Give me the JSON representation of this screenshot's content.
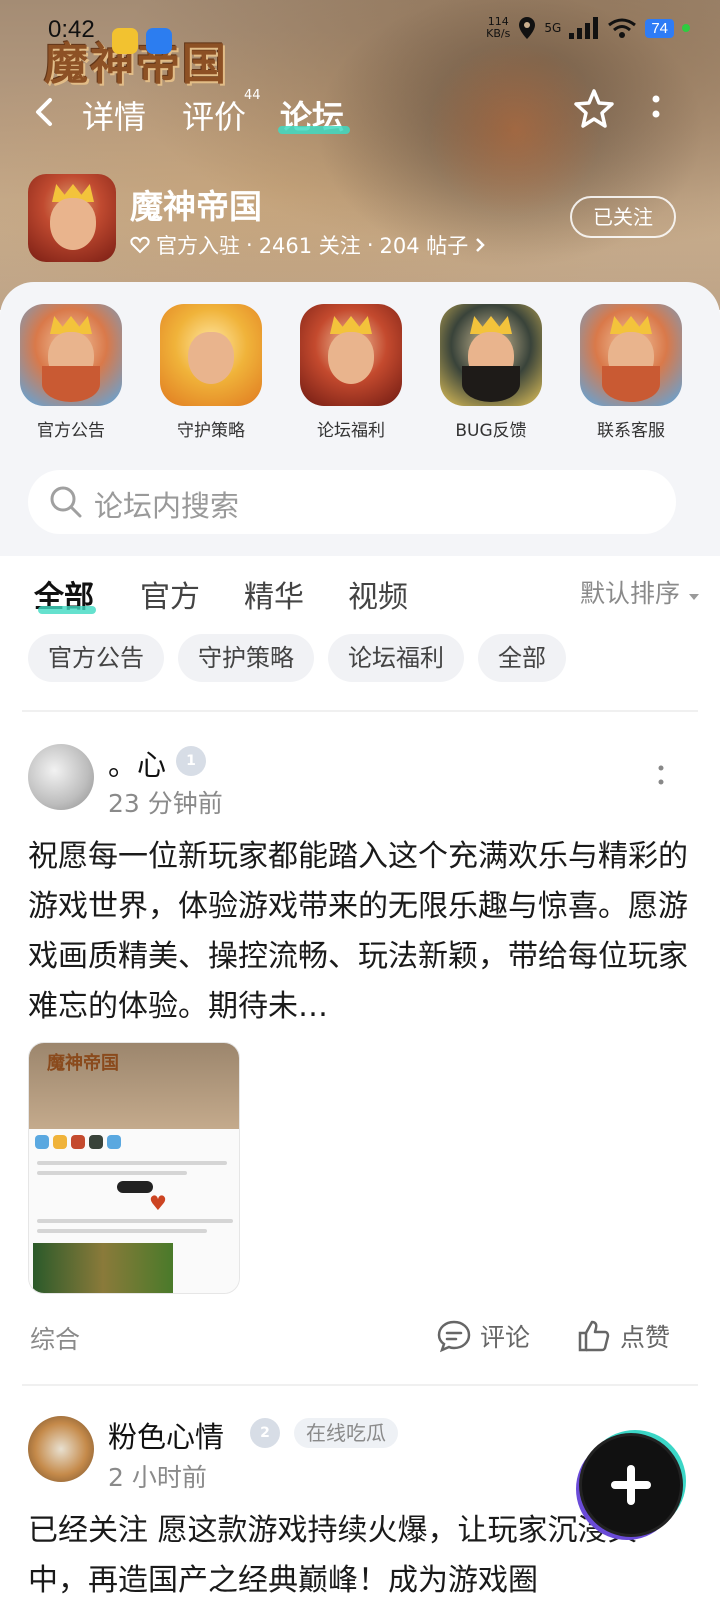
{
  "status_bar": {
    "time": "0:42",
    "net_speed": "114\nKB/s",
    "signal": "5G",
    "battery": "74"
  },
  "hero": {
    "logo_text": "魔神帝国"
  },
  "nav": {
    "tabs": [
      {
        "label": "详情"
      },
      {
        "label": "评价",
        "badge": "44"
      },
      {
        "label": "论坛"
      }
    ]
  },
  "game": {
    "name": "魔神帝国",
    "official": "官方入驻",
    "followers": "2461 关注",
    "posts": "204 帖子",
    "follow_button": "已关注"
  },
  "shortcuts": [
    {
      "label": "官方公告",
      "icon": "blue"
    },
    {
      "label": "守护策略",
      "icon": "gold"
    },
    {
      "label": "论坛福利",
      "icon": "red"
    },
    {
      "label": "BUG反馈",
      "icon": "dark"
    },
    {
      "label": "联系客服",
      "icon": "blue"
    }
  ],
  "search": {
    "placeholder": "论坛内搜索"
  },
  "filter_tabs": {
    "tabs": [
      "全部",
      "官方",
      "精华",
      "视频"
    ],
    "active": "全部",
    "sort": "默认排序"
  },
  "chips": [
    "官方公告",
    "守护策略",
    "论坛福利",
    "全部"
  ],
  "posts": [
    {
      "author": "。心",
      "level": "1",
      "time": "23 分钟前",
      "text": "祝愿每一位新玩家都能踏入这个充满欢乐与精彩的游戏世界，体验游戏带来的无限乐趣与惊喜。愿游戏画质精美、操控流畅、玩法新颖，带给每位玩家难忘的体验。期待未…",
      "category": "综合",
      "comment_label": "评论",
      "like_label": "点赞"
    },
    {
      "author": "粉色心情",
      "level": "2",
      "tag": "在线吃瓜",
      "time": "2 小时前",
      "text": "已经关注  愿这款游戏持续火爆，让玩家沉浸其中，再造国产之经典巅峰！成为游戏圈"
    }
  ],
  "colors": {
    "accent": "#3fd9c2",
    "battery": "#2e7cf6"
  }
}
